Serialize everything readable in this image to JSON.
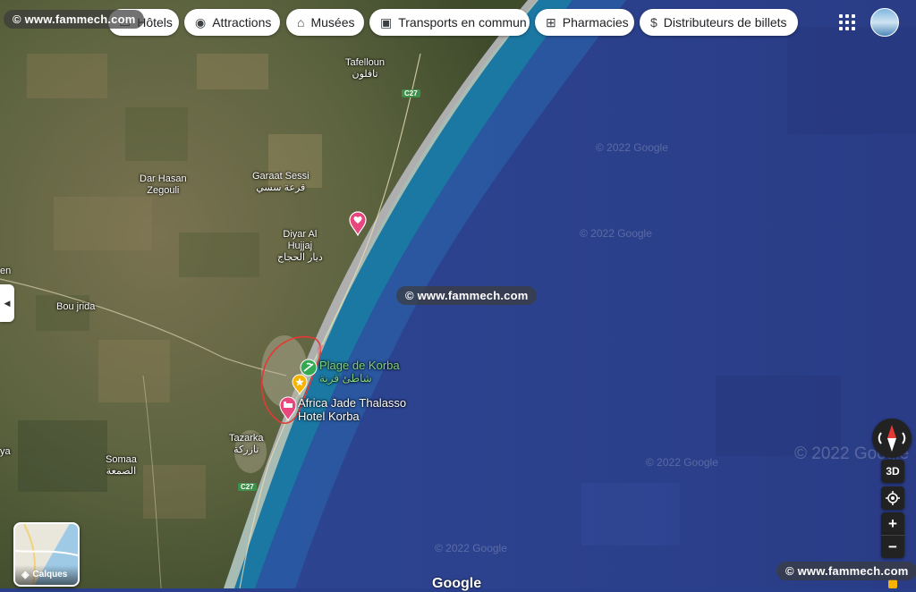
{
  "filter_chips": [
    {
      "label": "Hôtels",
      "icon": "bed-icon"
    },
    {
      "label": "Attractions",
      "icon": "camera-icon"
    },
    {
      "label": "Musées",
      "icon": "museum-icon"
    },
    {
      "label": "Transports en commun",
      "icon": "train-icon"
    },
    {
      "label": "Pharmacies",
      "icon": "pharmacy-icon"
    },
    {
      "label": "Distributeurs de billets",
      "icon": "atm-icon"
    }
  ],
  "watermarks": {
    "top": "© www.fammech.com",
    "center": "© www.fammech.com",
    "bottom": "© www.fammech.com"
  },
  "imagery_credits": [
    "© 2022 Google",
    "© 2022 Google",
    "© 2022 Google",
    "© 2022 Google",
    "© 2022 Google"
  ],
  "places": [
    {
      "name": "Tafelloun",
      "arabic": "تافلون"
    },
    {
      "name": "Garaat Sessi",
      "arabic": "قرعة سسي"
    },
    {
      "name": "Dar Hasan\nZegouli",
      "arabic": ""
    },
    {
      "name": "Diyar Al\nHujjaj",
      "arabic": "ديار الحجاج"
    },
    {
      "name": "Bou jrida",
      "arabic": ""
    },
    {
      "name": "Tazarka",
      "arabic": "تازركة"
    },
    {
      "name": "Somaa",
      "arabic": "الصمعة"
    },
    {
      "name": "en",
      "arabic": ""
    },
    {
      "name": "ya",
      "arabic": ""
    }
  ],
  "road_labels": [
    "C27",
    "C27"
  ],
  "pois": [
    {
      "name": "Plage de Korba",
      "arabic": "شاطئ قربة",
      "color": "#7ed37e"
    },
    {
      "name": "Africa Jade Thalasso\nHotel Korba",
      "arabic": "",
      "color": "#ffffff"
    }
  ],
  "layers": {
    "label": "Calques",
    "icon": "layers-icon"
  },
  "controls": {
    "three_d": "3D",
    "zoom_in": "+",
    "zoom_out": "−"
  },
  "logo": "Google",
  "colors": {
    "sea": "#2a3f8c",
    "coast": "#1a6f9a",
    "land": "#6b6a45",
    "highlight": "#e53935"
  }
}
